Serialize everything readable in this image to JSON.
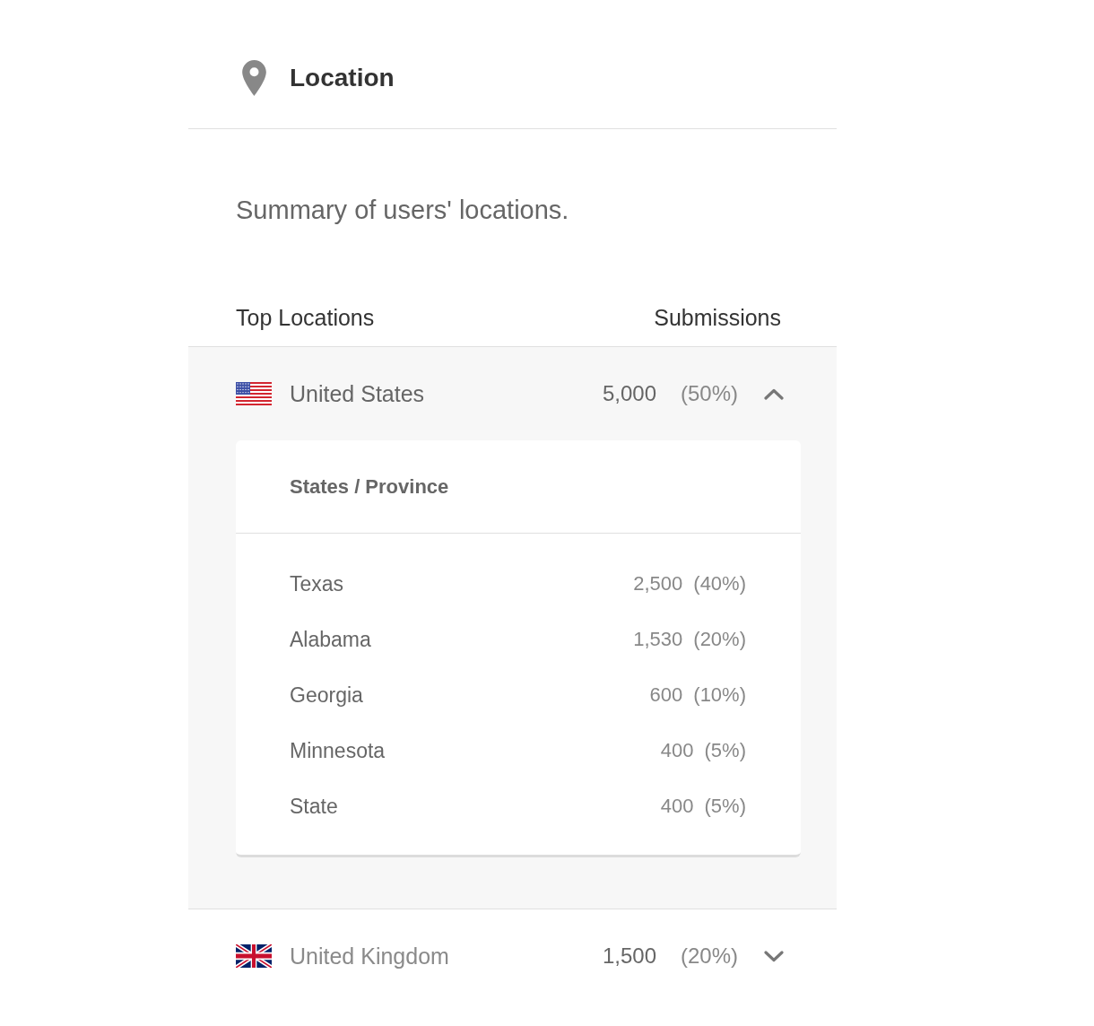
{
  "header": {
    "title": "Location"
  },
  "description": "Summary of users' locations.",
  "table": {
    "columns": [
      "Top Locations",
      "Submissions"
    ],
    "rows": [
      {
        "country": "United States",
        "kind": "us",
        "count": "5,000",
        "percent": "(50%)",
        "expanded": true,
        "subtable": {
          "heading": "States / Province",
          "rows": [
            {
              "name": "Texas",
              "count": "2,500",
              "percent": "(40%)"
            },
            {
              "name": "Alabama",
              "count": "1,530",
              "percent": "(20%)"
            },
            {
              "name": "Georgia",
              "count": "600",
              "percent": "(10%)"
            },
            {
              "name": "Minnesota",
              "count": "400",
              "percent": "(5%)"
            },
            {
              "name": "State",
              "count": "400",
              "percent": "(5%)"
            }
          ]
        }
      },
      {
        "country": "United Kingdom",
        "kind": "gb",
        "count": "1,500",
        "percent": "(20%)",
        "expanded": false
      }
    ]
  }
}
